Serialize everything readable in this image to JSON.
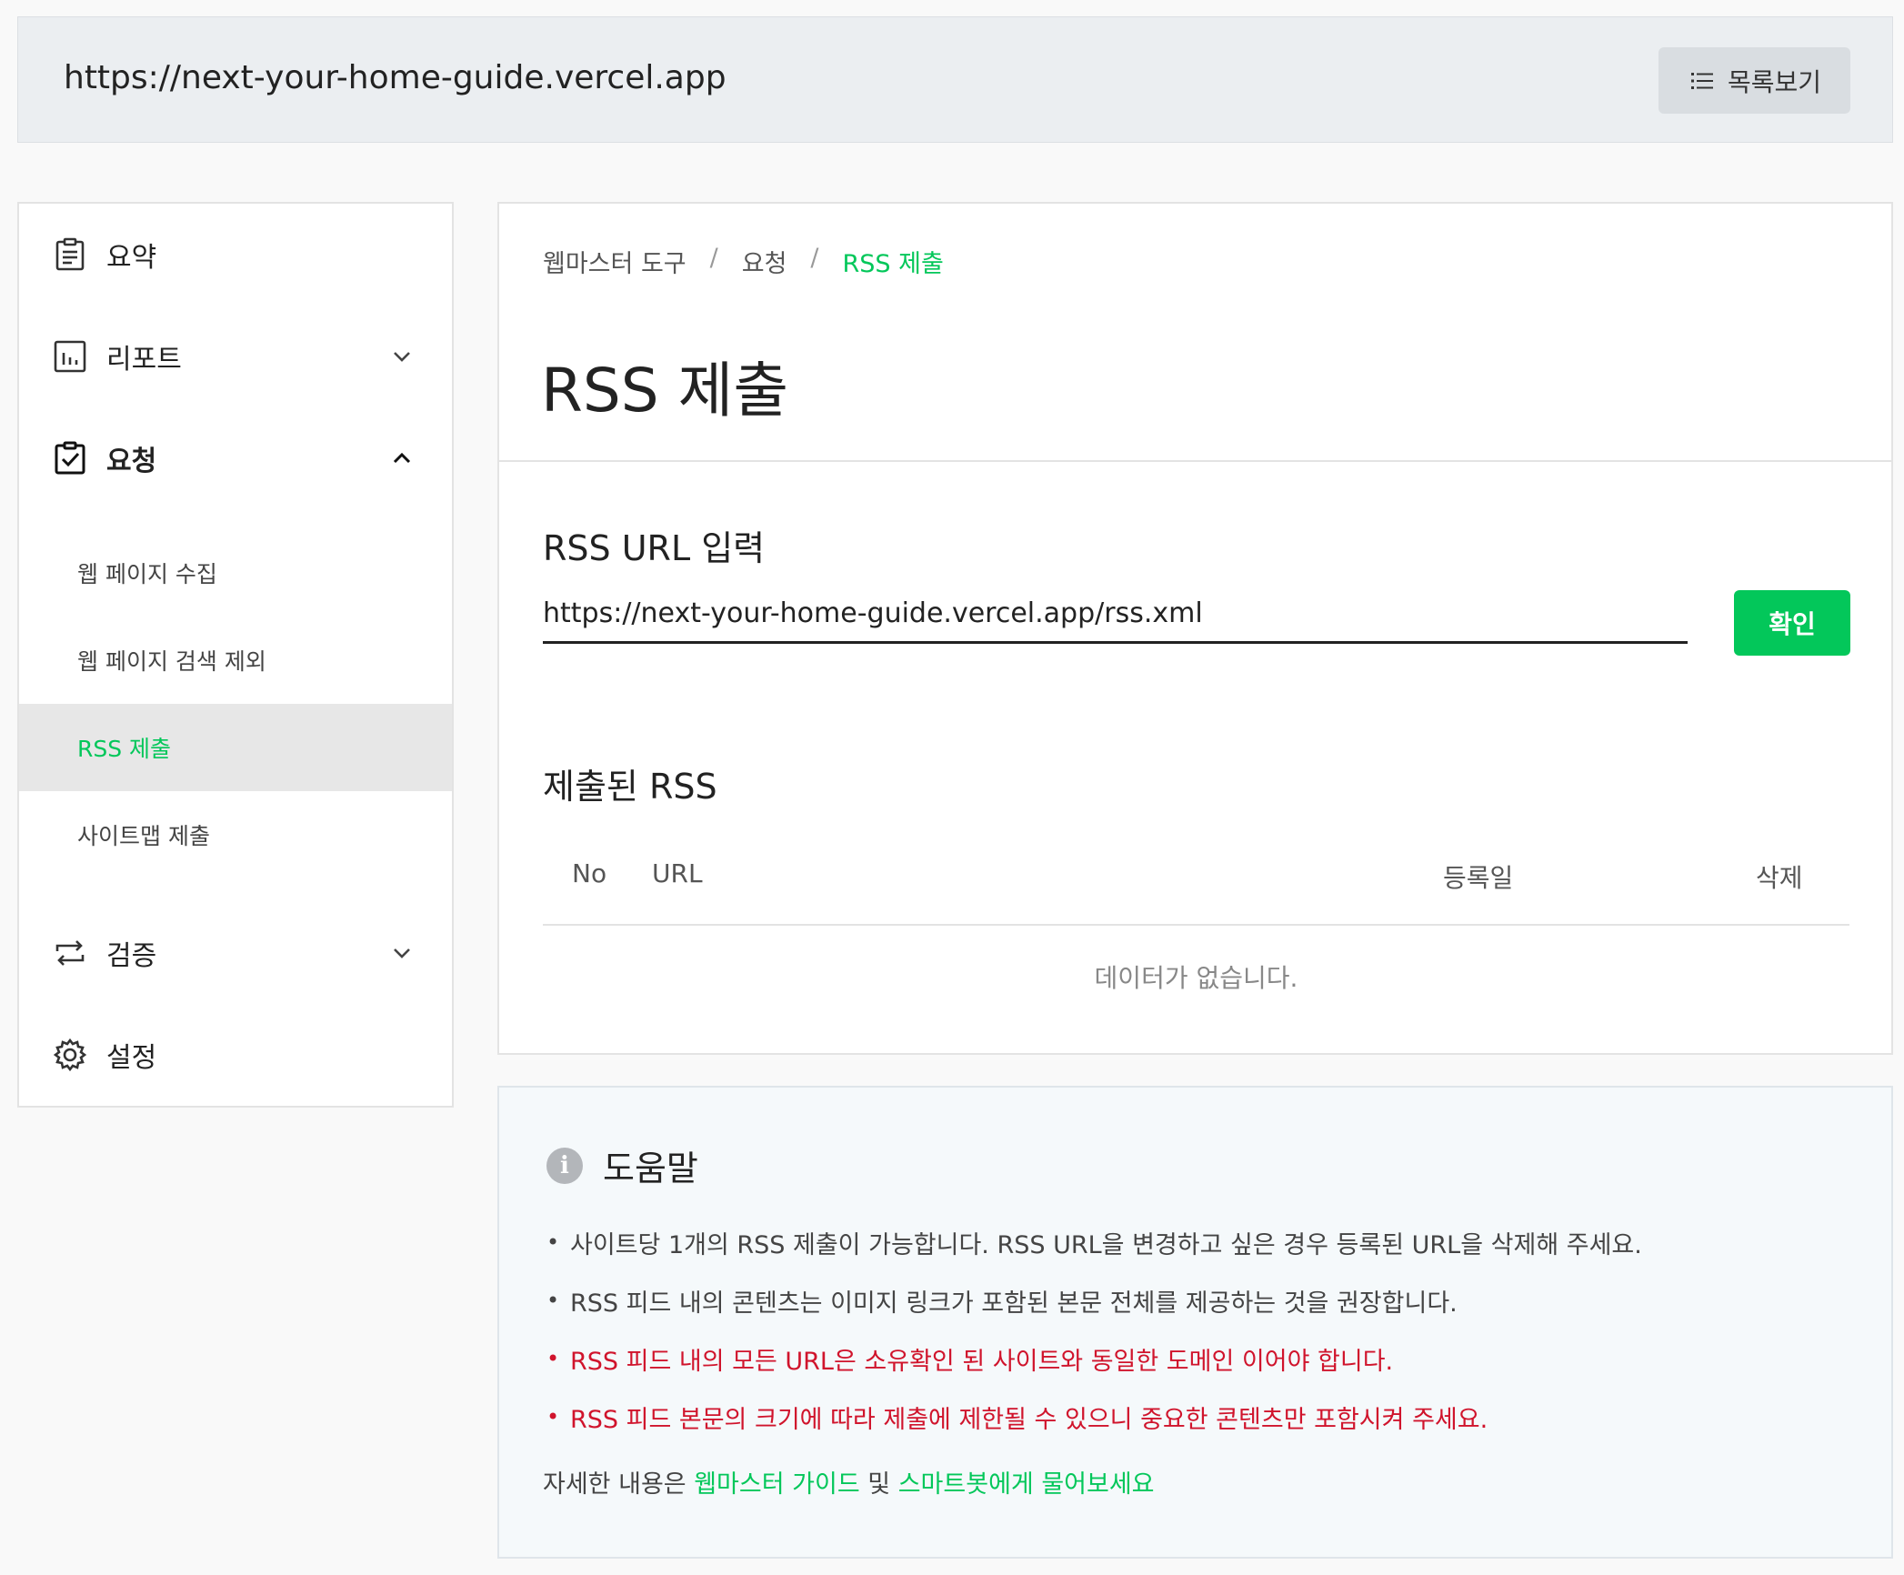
{
  "header": {
    "site_url": "https://next-your-home-guide.vercel.app",
    "list_button_label": "목록보기"
  },
  "sidebar": {
    "items": [
      {
        "label": "요약",
        "icon": "clipboard-list-icon"
      },
      {
        "label": "리포트",
        "icon": "bar-chart-icon"
      },
      {
        "label": "요청",
        "icon": "clipboard-check-icon",
        "expanded": true
      },
      {
        "label": "검증",
        "icon": "repeat-icon"
      },
      {
        "label": "설정",
        "icon": "gear-icon"
      }
    ],
    "sub_items": [
      {
        "label": "웹 페이지 수집"
      },
      {
        "label": "웹 페이지 검색 제외"
      },
      {
        "label": "RSS 제출",
        "active": true
      },
      {
        "label": "사이트맵 제출"
      }
    ]
  },
  "breadcrumb": {
    "items": [
      "웹마스터 도구",
      "요청",
      "RSS 제출"
    ],
    "separator": "/"
  },
  "page": {
    "title": "RSS 제출"
  },
  "rss_form": {
    "heading": "RSS URL 입력",
    "input_value": "https://next-your-home-guide.vercel.app/rss.xml",
    "confirm_label": "확인"
  },
  "submitted": {
    "heading": "제출된 RSS",
    "columns": [
      "No",
      "URL",
      "등록일",
      "삭제"
    ],
    "empty_message": "데이터가 없습니다."
  },
  "help": {
    "title": "도움말",
    "items": [
      {
        "text": "사이트당 1개의 RSS 제출이 가능합니다. RSS URL을 변경하고 싶은 경우 등록된 URL을 삭제해 주세요.",
        "warning": false
      },
      {
        "text": "RSS 피드 내의 콘텐츠는 이미지 링크가 포함된 본문 전체를 제공하는 것을 권장합니다.",
        "warning": false
      },
      {
        "text": "RSS 피드 내의 모든 URL은 소유확인 된 사이트와 동일한 도메인 이어야 합니다.",
        "warning": true
      },
      {
        "text": "RSS 피드 본문의 크기에 따라 제출에 제한될 수 있으니 중요한 콘텐츠만 포함시켜 주세요.",
        "warning": true
      }
    ],
    "footer_prefix": "자세한 내용은 ",
    "footer_link1": "웹마스터 가이드",
    "footer_mid": " 및 ",
    "footer_link2": "스마트봇에게 물어보세요"
  },
  "colors": {
    "accent": "#03c75a",
    "warning": "#d0142c",
    "topbar_bg": "#ebeef1"
  }
}
